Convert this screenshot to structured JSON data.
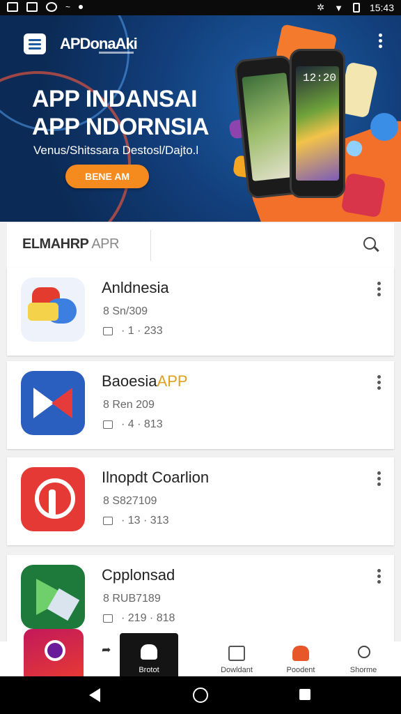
{
  "status_bar": {
    "time": "15:43"
  },
  "banner": {
    "brand": "APDonaAki",
    "headline_line1": "APP INDANSAI",
    "headline_line2": "APP NDORNSIA",
    "tagline": "Venus/Shitssara Destosl/Dajto.l",
    "cta_label": "BENE AM",
    "phone_clock": "12:20"
  },
  "search": {
    "brand_bold": "ELMAHRP",
    "brand_light": " APR",
    "placeholder": ""
  },
  "apps": [
    {
      "name": "Anldnesia",
      "name_accent": "",
      "meta1": "8 Sn/309",
      "meta2": "· 1 · 233",
      "icon": "chat-bubbles-icon",
      "colors": [
        "#f4d24a",
        "#3d7fe0",
        "#e43b2f"
      ]
    },
    {
      "name": "Baoesia",
      "name_accent": "APP",
      "meta1": "8 Ren 209",
      "meta2": "· 4 · 813",
      "icon": "m-logo-icon",
      "colors": [
        "#2b5fbf",
        "#ffffff",
        "#e63b3b"
      ]
    },
    {
      "name": "Ilnopdt Coarlion",
      "name_accent": "",
      "meta1": "8 S827109",
      "meta2": "· 13 · 313",
      "icon": "pin-logo-icon",
      "colors": [
        "#e53935",
        "#ffffff"
      ]
    },
    {
      "name": "Cpplonsad",
      "name_accent": "",
      "meta1": "8 RUB7189",
      "meta2": "· 219 · 818",
      "icon": "play-logo-icon",
      "colors": [
        "#1e7a3b",
        "#6fd06b",
        "#d9e4ef"
      ]
    }
  ],
  "bottom_nav": [
    {
      "label": "Brotot",
      "icon": "bot-icon",
      "active": true
    },
    {
      "label": "Dowldant",
      "icon": "download-icon",
      "active": false
    },
    {
      "label": "Poodent",
      "icon": "people-icon",
      "active": false
    },
    {
      "label": "Shorme",
      "icon": "search-icon",
      "active": false
    }
  ],
  "colors": {
    "accent_orange": "#f58a1f",
    "banner_blue": "#123e7a",
    "name_accent": "#e0a020"
  }
}
